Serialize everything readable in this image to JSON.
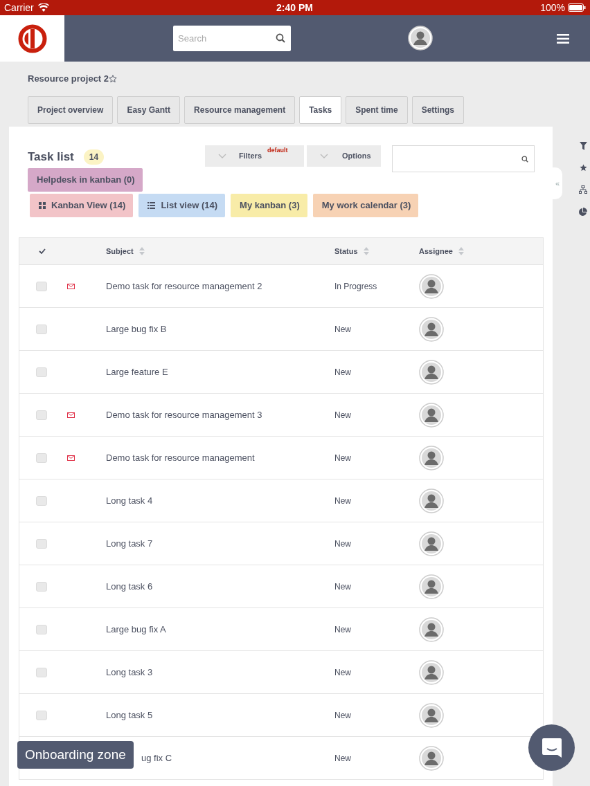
{
  "status_bar": {
    "carrier": "Carrier",
    "time": "2:40 PM",
    "battery": "100%"
  },
  "search": {
    "placeholder": "Search"
  },
  "project": {
    "title": "Resource project 2"
  },
  "tabs": [
    {
      "label": "Project overview",
      "selected": false
    },
    {
      "label": "Easy Gantt",
      "selected": false
    },
    {
      "label": "Resource management",
      "selected": false
    },
    {
      "label": "Tasks",
      "selected": true
    },
    {
      "label": "Spent time",
      "selected": false
    },
    {
      "label": "Settings",
      "selected": false
    }
  ],
  "task_list": {
    "title": "Task list",
    "count": "14",
    "filters": "Filters",
    "filters_badge": "default",
    "options": "Options"
  },
  "saved_queries": [
    {
      "label": "Helpdesk in kanban (0)",
      "color": "#d5a8c8",
      "kind": "plain"
    },
    {
      "label": "Kanban View (14)",
      "color": "#f2c4c8",
      "kind": "kanban"
    },
    {
      "label": "List view (14)",
      "color": "#c5dbf3",
      "kind": "list"
    },
    {
      "label": "My kanban (3)",
      "color": "#f8eca8",
      "kind": "plain"
    },
    {
      "label": "My work calendar (3)",
      "color": "#f7d2b4",
      "kind": "plain"
    }
  ],
  "sidebar_toggle": "«",
  "table": {
    "columns": [
      "Subject",
      "Status",
      "Assignee"
    ],
    "rows": [
      {
        "subject": "Demo task for resource management 2",
        "status": "In Progress",
        "mail": true,
        "checked": false,
        "kind": "full"
      },
      {
        "subject": "Large bug fix B",
        "status": "New",
        "mail": false,
        "checked": false,
        "kind": "full"
      },
      {
        "subject": "Large feature E",
        "status": "New",
        "mail": false,
        "checked": false,
        "kind": "full"
      },
      {
        "subject": "Demo task for resource management 3",
        "status": "New",
        "mail": true,
        "checked": false,
        "kind": "full"
      },
      {
        "subject": "Demo task for resource management",
        "status": "New",
        "mail": true,
        "checked": false,
        "kind": "full"
      },
      {
        "subject": "Long task 4",
        "status": "New",
        "mail": false,
        "checked": false,
        "kind": "full"
      },
      {
        "subject": "Long task 7",
        "status": "New",
        "mail": false,
        "checked": false,
        "kind": "full"
      },
      {
        "subject": "Long task 6",
        "status": "New",
        "mail": false,
        "checked": false,
        "kind": "full"
      },
      {
        "subject": "Large bug fix A",
        "status": "New",
        "mail": false,
        "checked": false,
        "kind": "full"
      },
      {
        "subject": "Long task 3",
        "status": "New",
        "mail": false,
        "checked": false,
        "kind": "full"
      },
      {
        "subject": "Long task 5",
        "status": "New",
        "mail": false,
        "checked": false,
        "kind": "full"
      },
      {
        "subject": "ug fix C",
        "status": "New",
        "kind": "partly_hidden"
      }
    ]
  },
  "onboarding": {
    "label": "Onboarding zone"
  }
}
